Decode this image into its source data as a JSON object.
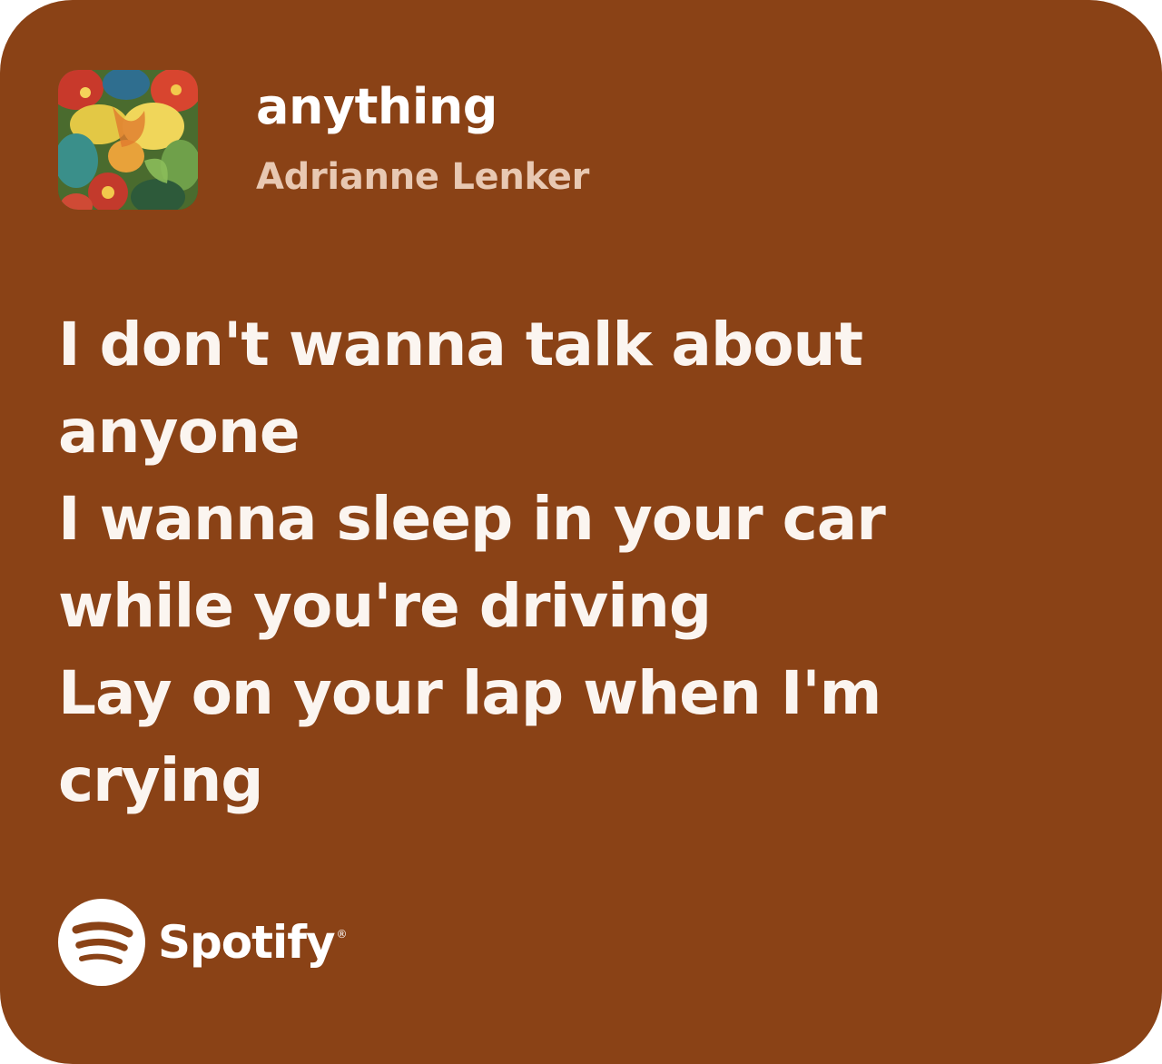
{
  "song": {
    "title": "anything",
    "artist": "Adrianne Lenker"
  },
  "lyrics": [
    "I don't wanna talk about",
    "anyone",
    "I wanna sleep in your car",
    "while you're driving",
    "Lay on your lap when I'm",
    "crying"
  ],
  "brand": {
    "name": "Spotify",
    "registered_mark": "®",
    "icon": "spotify-logo-icon"
  },
  "colors": {
    "background": "#8a4216",
    "title": "#ffffff",
    "artist": "#e8c8b2",
    "lyrics": "#fbf5f0"
  }
}
